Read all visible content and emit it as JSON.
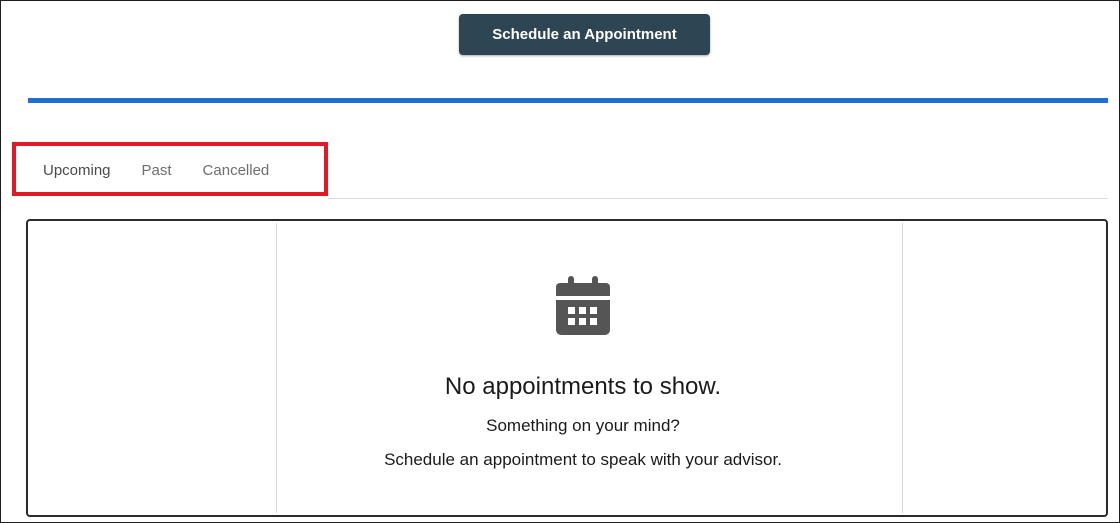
{
  "header": {
    "schedule_button_label": "Schedule an Appointment"
  },
  "tabs": [
    {
      "label": "Upcoming",
      "active": true
    },
    {
      "label": "Past",
      "active": false
    },
    {
      "label": "Cancelled",
      "active": false
    }
  ],
  "empty_state": {
    "icon": "calendar-icon",
    "title": "No appointments to show.",
    "line1": "Something on your mind?",
    "line2": "Schedule an appointment to speak with your advisor."
  },
  "colors": {
    "button_bg": "#2e4553",
    "accent_rule": "#1f6fd0",
    "highlight": "#e01b24",
    "icon": "#555555"
  }
}
